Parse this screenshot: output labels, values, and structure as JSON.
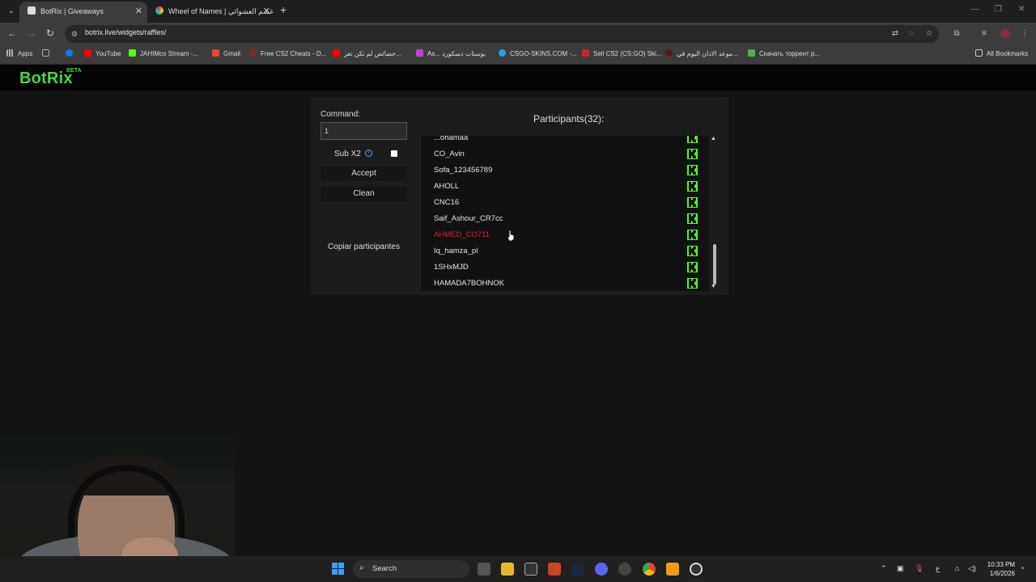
{
  "browser": {
    "tabs": [
      {
        "label": "BotRix | Giveaways",
        "active": true
      },
      {
        "label": "Wheel of Names | غسم العشوائي",
        "active": false
      }
    ],
    "url": "botrix.live/widgets/raffles/",
    "bookmarks": [
      {
        "label": "Apps"
      },
      {
        "label": "YouTube"
      },
      {
        "label": "JAHIMco Stream -..."
      },
      {
        "label": "Gmail"
      },
      {
        "label": "Free CS2 Cheats - D..."
      },
      {
        "label": "خصائص لم تكن تعر..."
      },
      {
        "label": "As... بوستات دسكورد"
      },
      {
        "label": "CSGO-SKINS.COM -..."
      },
      {
        "label": "Sell CS2 (CS:GO) Ski..."
      },
      {
        "label": "موعد الاذان اليوم في..."
      },
      {
        "label": "Скачать торрент р..."
      },
      {
        "label": "All Bookmarks"
      }
    ]
  },
  "app": {
    "logo": "BotRix",
    "logo_badge": "BETA"
  },
  "raffle": {
    "command_label": "Command:",
    "command_value": "1",
    "sub_label": "Sub X2",
    "sub_checked": false,
    "accept_label": "Accept",
    "clean_label": "Clean",
    "copy_label": "Copiar participantes",
    "participants_title": "Participants(32):",
    "participants": [
      {
        "name": "...ohamaa",
        "highlight": false
      },
      {
        "name": "CO_Avin",
        "highlight": false
      },
      {
        "name": "Sofa_123456789",
        "highlight": false
      },
      {
        "name": "AHOLL",
        "highlight": false
      },
      {
        "name": "CNC16",
        "highlight": false
      },
      {
        "name": "Saif_Ashour_CR7cc",
        "highlight": false
      },
      {
        "name": "AHMED_CO711",
        "highlight": true
      },
      {
        "name": "Iq_hamza_pl",
        "highlight": false
      },
      {
        "name": "1SHxMJD",
        "highlight": false
      },
      {
        "name": "HAMADA7BOHNOK",
        "highlight": false
      },
      {
        "name": "",
        "highlight": false
      }
    ]
  },
  "taskbar": {
    "search_label": "Search",
    "time": "10:33 PM",
    "date": "1/6/2026",
    "lang": "ع"
  }
}
